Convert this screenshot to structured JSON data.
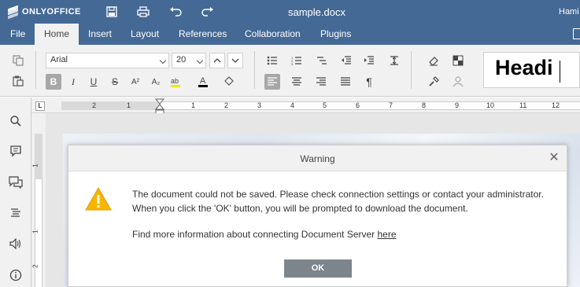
{
  "titlebar": {
    "logo_text": "ONLYOFFICE",
    "document_title": "sample.docx",
    "user_name": "Hami",
    "icons": [
      "save-icon",
      "print-icon",
      "undo-icon",
      "redo-icon"
    ]
  },
  "tabs": [
    {
      "label": "File"
    },
    {
      "label": "Home"
    },
    {
      "label": "Insert"
    },
    {
      "label": "Layout"
    },
    {
      "label": "References"
    },
    {
      "label": "Collaboration"
    },
    {
      "label": "Plugins"
    }
  ],
  "active_tab": "Home",
  "toolbar": {
    "font_name": "Arial",
    "font_size": "20",
    "style_preview": "Headi"
  },
  "ruler": {
    "h_numbers": [
      "2",
      "1",
      "1",
      "2",
      "3",
      "4",
      "5",
      "6",
      "7",
      "8",
      "9",
      "10",
      "11",
      "12"
    ],
    "v_numbers": [
      "1",
      "1",
      "2"
    ],
    "tab_type": "L"
  },
  "sidebar_icons": [
    "search-icon",
    "comments-icon",
    "chat-icon",
    "navigation-icon",
    "speaker-icon",
    "about-icon"
  ],
  "dialog": {
    "title": "Warning",
    "line1": "The document could not be saved. Please check connection settings or contact your administrator.",
    "line2": "When you click the 'OK' button, you will be prompted to download the document.",
    "line3_prefix": "Find more information about connecting Document Server ",
    "line3_link": "here",
    "ok_label": "OK"
  },
  "colors": {
    "header_bg": "#446995",
    "toolbar_bg": "#f1f1f1",
    "ok_button_bg": "#7d858c",
    "warning_yellow": "#f7b500"
  }
}
